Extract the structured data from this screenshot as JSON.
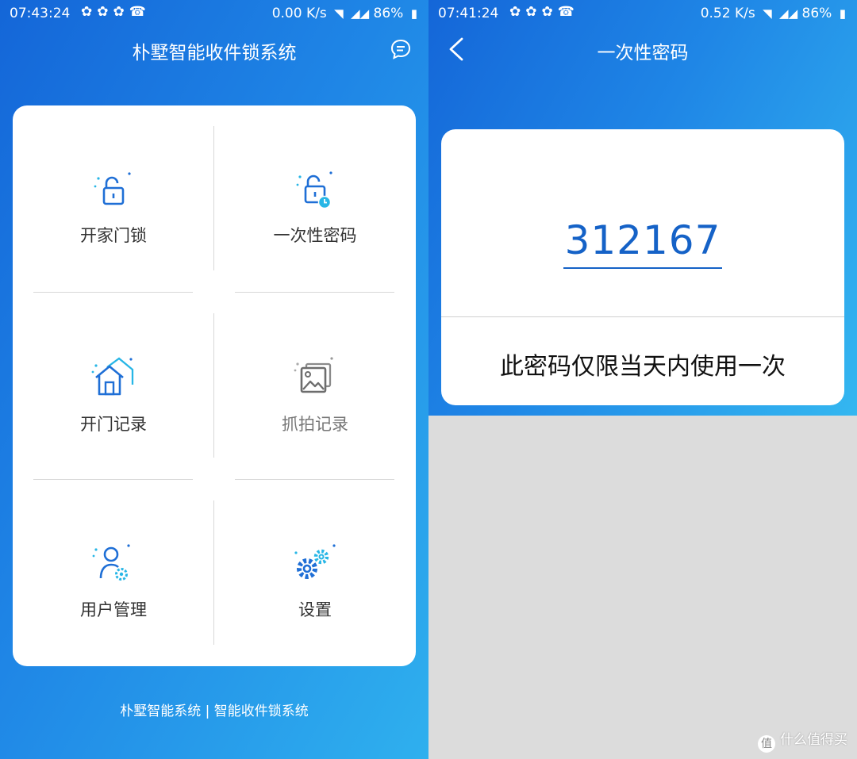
{
  "left": {
    "status": {
      "time": "07:43:24",
      "speed": "0.00 K/s",
      "battery": "86%"
    },
    "title": "朴墅智能收件锁系统",
    "menu": [
      {
        "label": "开家门锁",
        "icon": "unlock-icon"
      },
      {
        "label": "一次性密码",
        "icon": "one-time-password-icon"
      },
      {
        "label": "开门记录",
        "icon": "house-icon"
      },
      {
        "label": "抓拍记录",
        "icon": "photo-gallery-icon"
      },
      {
        "label": "用户管理",
        "icon": "user-gear-icon"
      },
      {
        "label": "设置",
        "icon": "gears-icon"
      }
    ],
    "footer": "朴墅智能系统 | 智能收件锁系统"
  },
  "right": {
    "status": {
      "time": "07:41:24",
      "speed": "0.52 K/s",
      "battery": "86%"
    },
    "title": "一次性密码",
    "password": "312167",
    "note": "此密码仅限当天内使用一次"
  },
  "watermark": {
    "logo": "值",
    "text": "什么值得买"
  },
  "colors": {
    "primary_blue": "#1f86e6",
    "password_blue": "#1562c7",
    "accent_cyan": "#27b6e6"
  }
}
